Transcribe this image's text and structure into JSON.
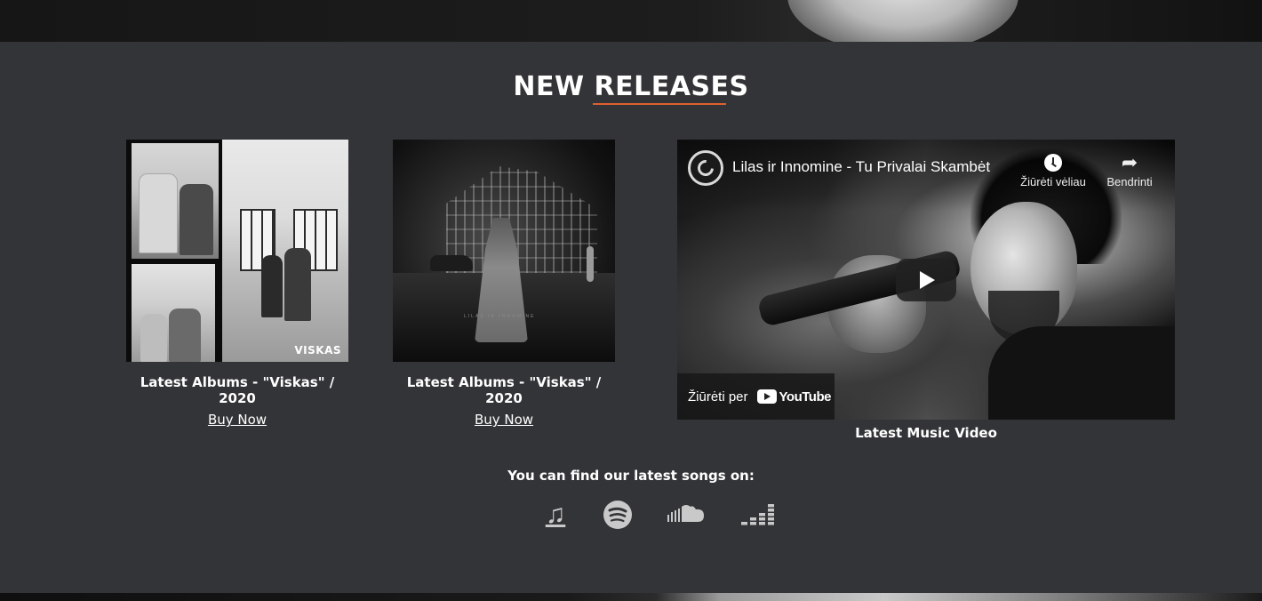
{
  "section": {
    "title": "New Releases",
    "accent_color": "#e0602f"
  },
  "albums": [
    {
      "caption": "Latest Albums - \"Viskas\" / 2020",
      "buy_label": "Buy Now",
      "cover_text": "VISKAS"
    },
    {
      "caption": "Latest Albums - \"Viskas\" / 2020",
      "buy_label": "Buy Now",
      "cover_text": "LILAS IR INNOMINE"
    }
  ],
  "video": {
    "title": "Lilas ir Innomine - Tu Privalai Skambėt",
    "watch_later_label": "Žiūrėti vėliau",
    "share_label": "Bendrinti",
    "watch_on_label": "Žiūrėti per",
    "youtube_label": "YouTube",
    "caption": "Latest Music Video"
  },
  "platforms": {
    "label": "You can find our latest songs on:",
    "items": [
      {
        "name": "apple-music",
        "icon": "music-note-icon"
      },
      {
        "name": "spotify",
        "icon": "spotify-icon"
      },
      {
        "name": "soundcloud",
        "icon": "soundcloud-icon"
      },
      {
        "name": "deezer",
        "icon": "deezer-icon"
      }
    ]
  }
}
